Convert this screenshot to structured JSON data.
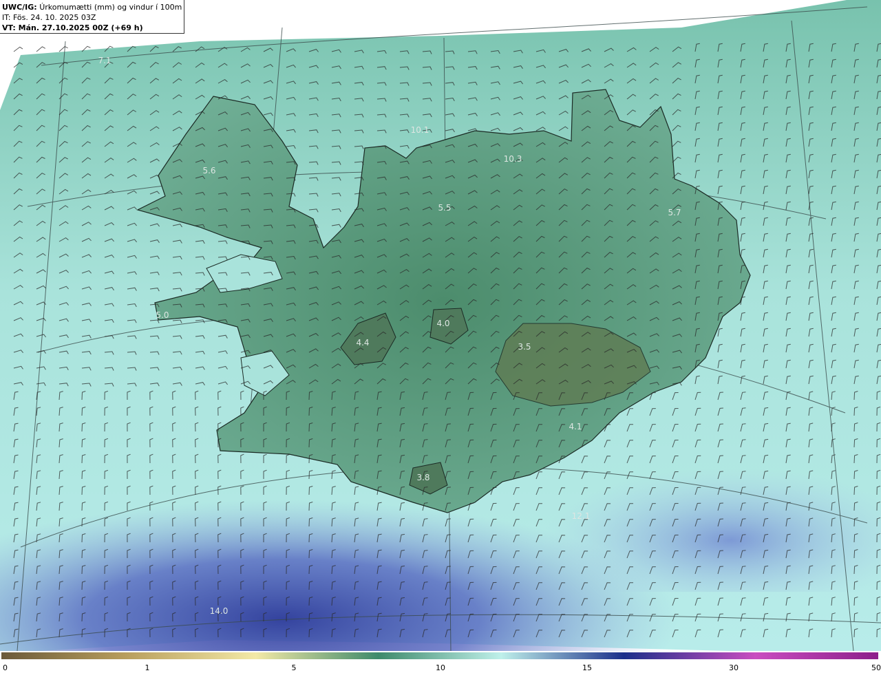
{
  "info": {
    "model": "UWC/IG:",
    "title": "Úrkomumætti (mm) og vindur í 100m hæð",
    "it": "IT: Fös. 24. 10. 2025 03Z",
    "vt": "VT: Mán. 27.10.2025 00Z (+69 h)"
  },
  "colorbar": {
    "ticks": [
      "0",
      "1",
      "5",
      "10",
      "15",
      "30",
      "50"
    ],
    "colors": [
      "#6b5a3a",
      "#b79d5c",
      "#f3e9a6",
      "#3e8a6b",
      "#bff0ea",
      "#1b2f8a",
      "#c94dc0",
      "#8d1f8a"
    ]
  },
  "values": [
    {
      "label": "7.1"
    },
    {
      "label": "10.1"
    },
    {
      "label": "10.3"
    },
    {
      "label": "5.6"
    },
    {
      "label": "5.5"
    },
    {
      "label": "5.7"
    },
    {
      "label": "5.0"
    },
    {
      "label": "4.4"
    },
    {
      "label": "4.0"
    },
    {
      "label": "3.5"
    },
    {
      "label": "4.1"
    },
    {
      "label": "3.8"
    },
    {
      "label": "12.1"
    },
    {
      "label": "14.0"
    }
  ],
  "colors": {
    "sea": "#a9e3db",
    "land_high": "#3c7a5c",
    "land_low": "#6fb59a",
    "rain_heavy": "#3f4fb0",
    "rain_mid": "#7f93d6"
  }
}
